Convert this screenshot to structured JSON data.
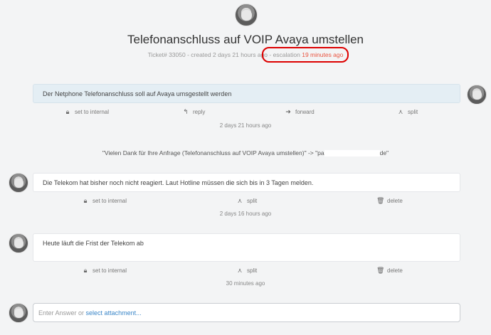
{
  "ticket": {
    "title": "Telefonanschluss auf VOIP Avaya umstellen",
    "meta_prefix": "Ticket# 33050 - created 2 days 21 hours ago",
    "escalation_label": " - escalation",
    "escalation_time": "19 minutes ago"
  },
  "articles": [
    {
      "text": "Der Netphone Telefonanschluss soll auf Avaya umsgestellt werden",
      "actions": [
        "set to internal",
        "reply",
        "forward",
        "split"
      ],
      "time": "2 days 21 hours ago"
    },
    {
      "system_left": "\"Vielen Dank für Ihre Anfrage (Telefonanschluss auf VOIP Avaya umstellen)\" -> \"pa",
      "system_right": "de\""
    },
    {
      "text": "Die Telekom hat bisher noch nicht reagiert. Laut Hotline müssen die sich bis in 3 Tagen melden.",
      "actions": [
        "set to internal",
        "split",
        "delete"
      ],
      "time": "2 days 16 hours ago"
    },
    {
      "text": "Heute läuft die Frist der Telekom ab",
      "actions": [
        "set to internal",
        "split",
        "delete"
      ],
      "time": "30 minutes ago"
    }
  ],
  "composer": {
    "placeholder_prefix": "Enter Answer or",
    "link": "select attachment..."
  },
  "icons": {
    "lock": "lock-icon",
    "reply": "reply-icon",
    "forward": "forward-icon",
    "split": "split-icon",
    "delete": "trash-icon"
  },
  "colors": {
    "escalation": "#e9533f",
    "highlight_ring": "#dd0000",
    "agent_bubble": "#e4eef4",
    "link": "#3a86c8"
  }
}
